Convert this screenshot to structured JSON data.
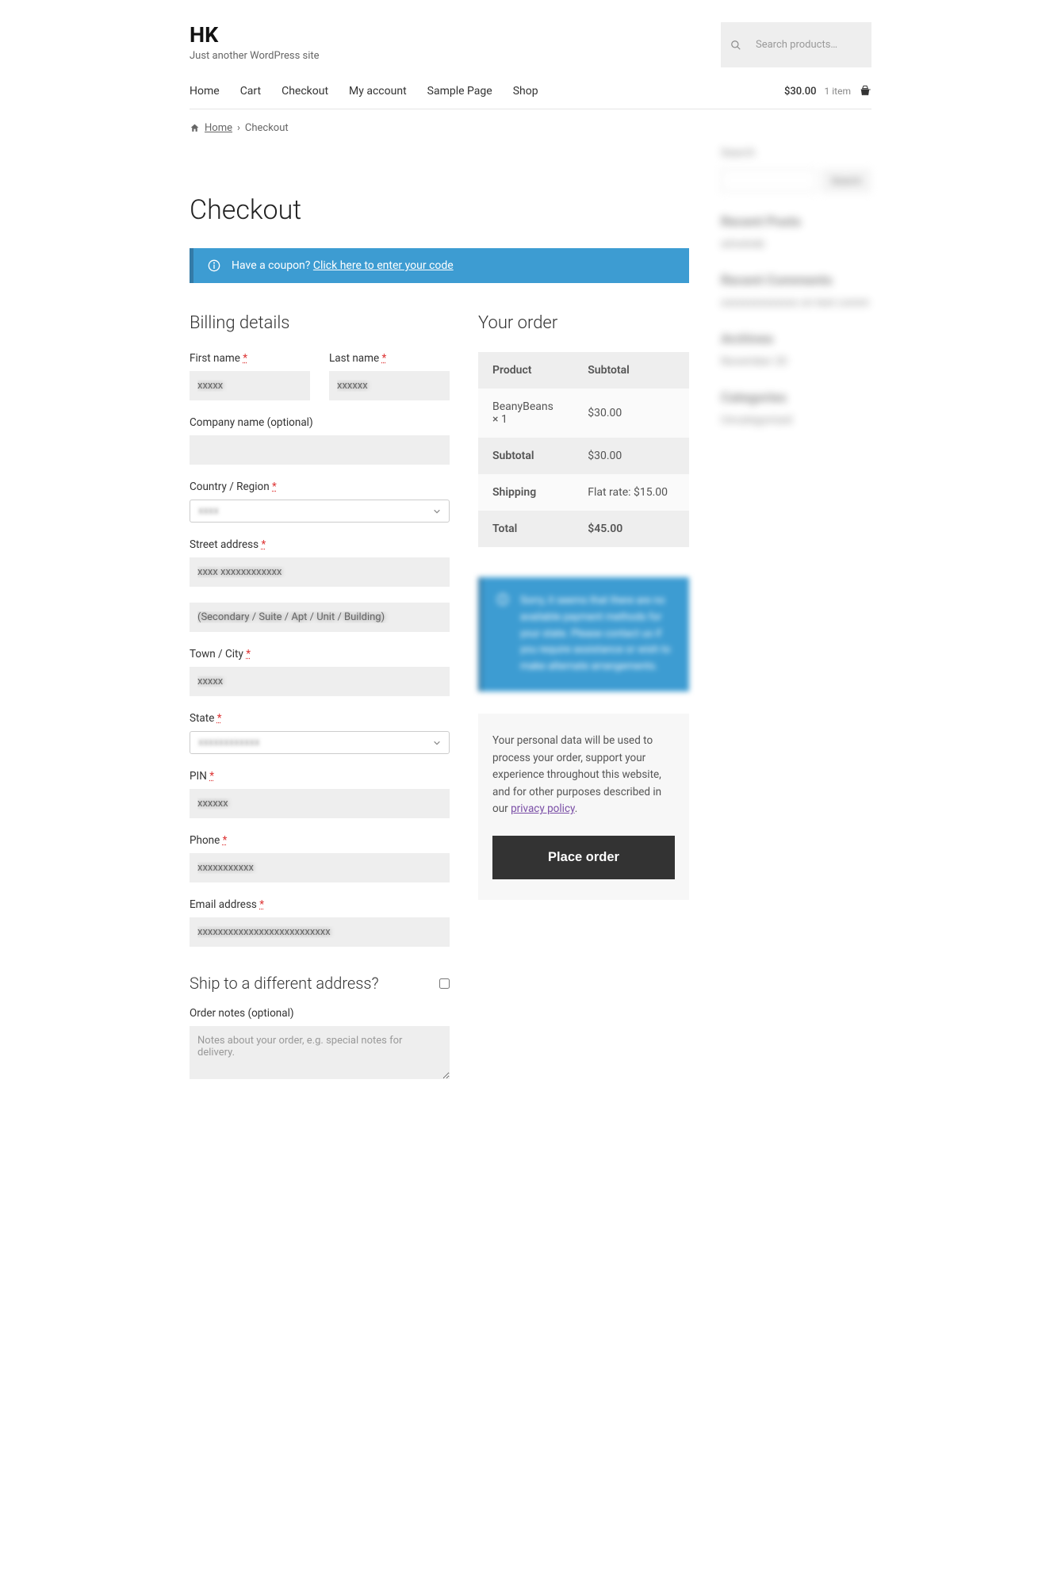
{
  "site": {
    "title": "HK",
    "tagline": "Just another WordPress site"
  },
  "search": {
    "placeholder": "Search products…"
  },
  "nav": [
    "Home",
    "Cart",
    "Checkout",
    "My account",
    "Sample Page",
    "Shop"
  ],
  "cart": {
    "amount": "$30.00",
    "count": "1 item"
  },
  "breadcrumb": {
    "home": "Home",
    "current": "Checkout"
  },
  "page": {
    "title": "Checkout"
  },
  "coupon": {
    "prompt": "Have a coupon?",
    "link": "Click here to enter your code"
  },
  "billing": {
    "heading": "Billing details",
    "first_name": {
      "label": "First name",
      "value": "xxxxx"
    },
    "last_name": {
      "label": "Last name",
      "value": "xxxxxx"
    },
    "company": {
      "label": "Company name (optional)"
    },
    "country": {
      "label": "Country / Region",
      "value": "xxxx"
    },
    "street": {
      "label": "Street address",
      "value1": "xxxx xxxxxxxxxxxx",
      "placeholder2": "(Secondary / Suite / Apt / Unit / Building)"
    },
    "city": {
      "label": "Town / City",
      "value": "xxxxx"
    },
    "state": {
      "label": "State",
      "value": "xxxxxxxxxxxx"
    },
    "pin": {
      "label": "PIN",
      "value": "xxxxxx"
    },
    "phone": {
      "label": "Phone",
      "value": "xxxxxxxxxxx"
    },
    "email": {
      "label": "Email address",
      "value": "xxxxxxxxxxxxxxxxxxxxxxxxxx"
    }
  },
  "ship": {
    "heading": "Ship to a different address?"
  },
  "notes": {
    "label": "Order notes (optional)",
    "placeholder": "Notes about your order, e.g. special notes for delivery."
  },
  "order": {
    "heading": "Your order",
    "cols": {
      "product": "Product",
      "subtotal": "Subtotal"
    },
    "items": [
      {
        "name": "BeanyBeans",
        "qty": "× 1",
        "line": "$30.00"
      }
    ],
    "subtotal": {
      "label": "Subtotal",
      "value": "$30.00"
    },
    "shipping": {
      "label": "Shipping",
      "value": "Flat rate: $15.00"
    },
    "total": {
      "label": "Total",
      "value": "$45.00"
    }
  },
  "payment_notice": "Sorry, it seems that there are no available payment methods for your state. Please contact us if you require assistance or wish to make alternate arrangements.",
  "privacy": {
    "text": "Your personal data will be used to process your order, support your experience throughout this website, and for other purposes described in our ",
    "link": "privacy policy"
  },
  "place_order": "Place order",
  "sidebar": {
    "search": {
      "label": "Search",
      "button": "Search"
    },
    "recent_posts": {
      "title": "Recent Posts",
      "items": [
        "wtrwtreb"
      ]
    },
    "recent_comments": {
      "title": "Recent Comments",
      "items": [
        "xxxxxxxxxxxxxx on test comm"
      ]
    },
    "archives": {
      "title": "Archives",
      "items": [
        "November 20"
      ]
    },
    "categories": {
      "title": "Categories",
      "items": [
        "Uncategorized"
      ]
    }
  }
}
